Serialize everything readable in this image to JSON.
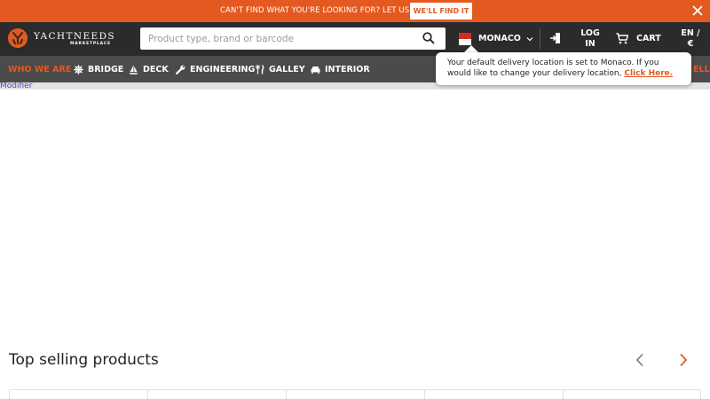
{
  "promo": {
    "text": "CAN'T FIND WHAT YOU'RE LOOKING FOR? LET US KNOW",
    "button": "WE'LL FIND IT",
    "close_icon": "close-icon"
  },
  "header": {
    "logo_name": "YACHTNEEDS",
    "logo_sub": "MARKETPLACE",
    "search_placeholder": "Product type, brand or barcode",
    "country": "MONACO",
    "login": "LOG IN",
    "cart": "CART",
    "language": "EN / €"
  },
  "nav": {
    "items": [
      {
        "label": "WHO WE ARE",
        "icon": ""
      },
      {
        "label": "BRIDGE",
        "icon": "wheel-icon"
      },
      {
        "label": "DECK",
        "icon": "sailboat-icon"
      },
      {
        "label": "ENGINEERING",
        "icon": "wrench-icon"
      },
      {
        "label": "GALLEY",
        "icon": "cutlery-icon"
      },
      {
        "label": "INTERIOR",
        "icon": "sofa-icon"
      }
    ],
    "tail": "ELLER"
  },
  "tooltip": {
    "text": "Your default delivery location is set to Monaco. If you would like to change your delivery location, ",
    "link": "Click Here."
  },
  "strip": {
    "text": "Modifier"
  },
  "top_selling": {
    "title": "Top selling products"
  },
  "colors": {
    "accent": "#e3591f",
    "header_bg": "#2b2b2b",
    "nav_bg": "#4b4b4b"
  }
}
